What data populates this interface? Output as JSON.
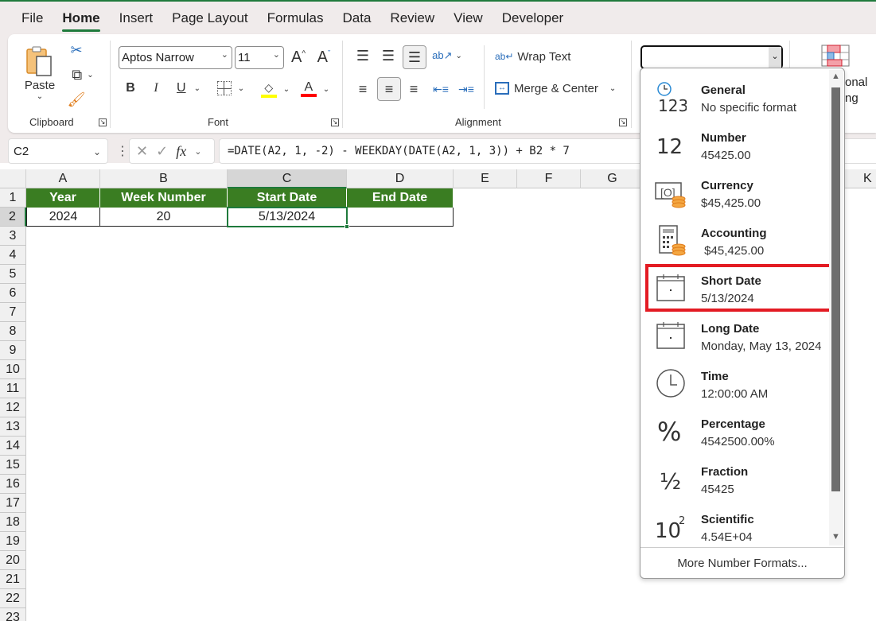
{
  "tabs": [
    "File",
    "Home",
    "Insert",
    "Page Layout",
    "Formulas",
    "Data",
    "Review",
    "View",
    "Developer"
  ],
  "active_tab": "Home",
  "ribbon": {
    "clipboard": {
      "paste_label": "Paste",
      "group_label": "Clipboard"
    },
    "font": {
      "font_name": "Aptos Narrow",
      "font_size": "11",
      "group_label": "Font",
      "highlight_color": "#ffff00",
      "font_color": "#ff0000"
    },
    "alignment": {
      "wrap_text": "Wrap Text",
      "merge_center": "Merge & Center",
      "group_label": "Alignment"
    },
    "number_format_value": "",
    "conditional_formatting_partial": [
      "onal",
      "ng"
    ]
  },
  "formula_bar": {
    "name_box": "C2",
    "formula": "=DATE(A2, 1, -2) - WEEKDAY(DATE(A2, 1, 3)) + B2 * 7"
  },
  "sheet": {
    "columns": [
      "A",
      "B",
      "C",
      "D",
      "E",
      "F",
      "G",
      "K"
    ],
    "rows": [
      "1",
      "2",
      "3",
      "4",
      "5",
      "6",
      "7",
      "8",
      "9",
      "10",
      "11",
      "12",
      "13",
      "14",
      "15",
      "16",
      "17",
      "18",
      "19",
      "20",
      "21",
      "22",
      "23"
    ],
    "headers": [
      "Year",
      "Week Number",
      "Start Date",
      "End Date"
    ],
    "row2": [
      "2024",
      "20",
      "5/13/2024",
      ""
    ],
    "header_fill": "#3a7d22"
  },
  "number_format_menu": {
    "items": [
      {
        "title": "General",
        "sample": "No specific format",
        "icon": "general-icon"
      },
      {
        "title": "Number",
        "sample": "45425.00",
        "icon": "number-icon"
      },
      {
        "title": "Currency",
        "sample": "$45,425.00",
        "icon": "currency-icon"
      },
      {
        "title": "Accounting",
        "sample": " $45,425.00",
        "icon": "accounting-icon"
      },
      {
        "title": "Short Date",
        "sample": "5/13/2024",
        "icon": "calendar-icon"
      },
      {
        "title": "Long Date",
        "sample": "Monday, May 13, 2024",
        "icon": "calendar-icon"
      },
      {
        "title": "Time",
        "sample": "12:00:00 AM",
        "icon": "clock-icon"
      },
      {
        "title": "Percentage",
        "sample": "4542500.00%",
        "icon": "percent-icon"
      },
      {
        "title": "Fraction",
        "sample": "45425",
        "icon": "fraction-icon"
      },
      {
        "title": "Scientific",
        "sample": "4.54E+04",
        "icon": "scientific-icon"
      }
    ],
    "highlighted": "Short Date",
    "footer": "More Number Formats..."
  }
}
